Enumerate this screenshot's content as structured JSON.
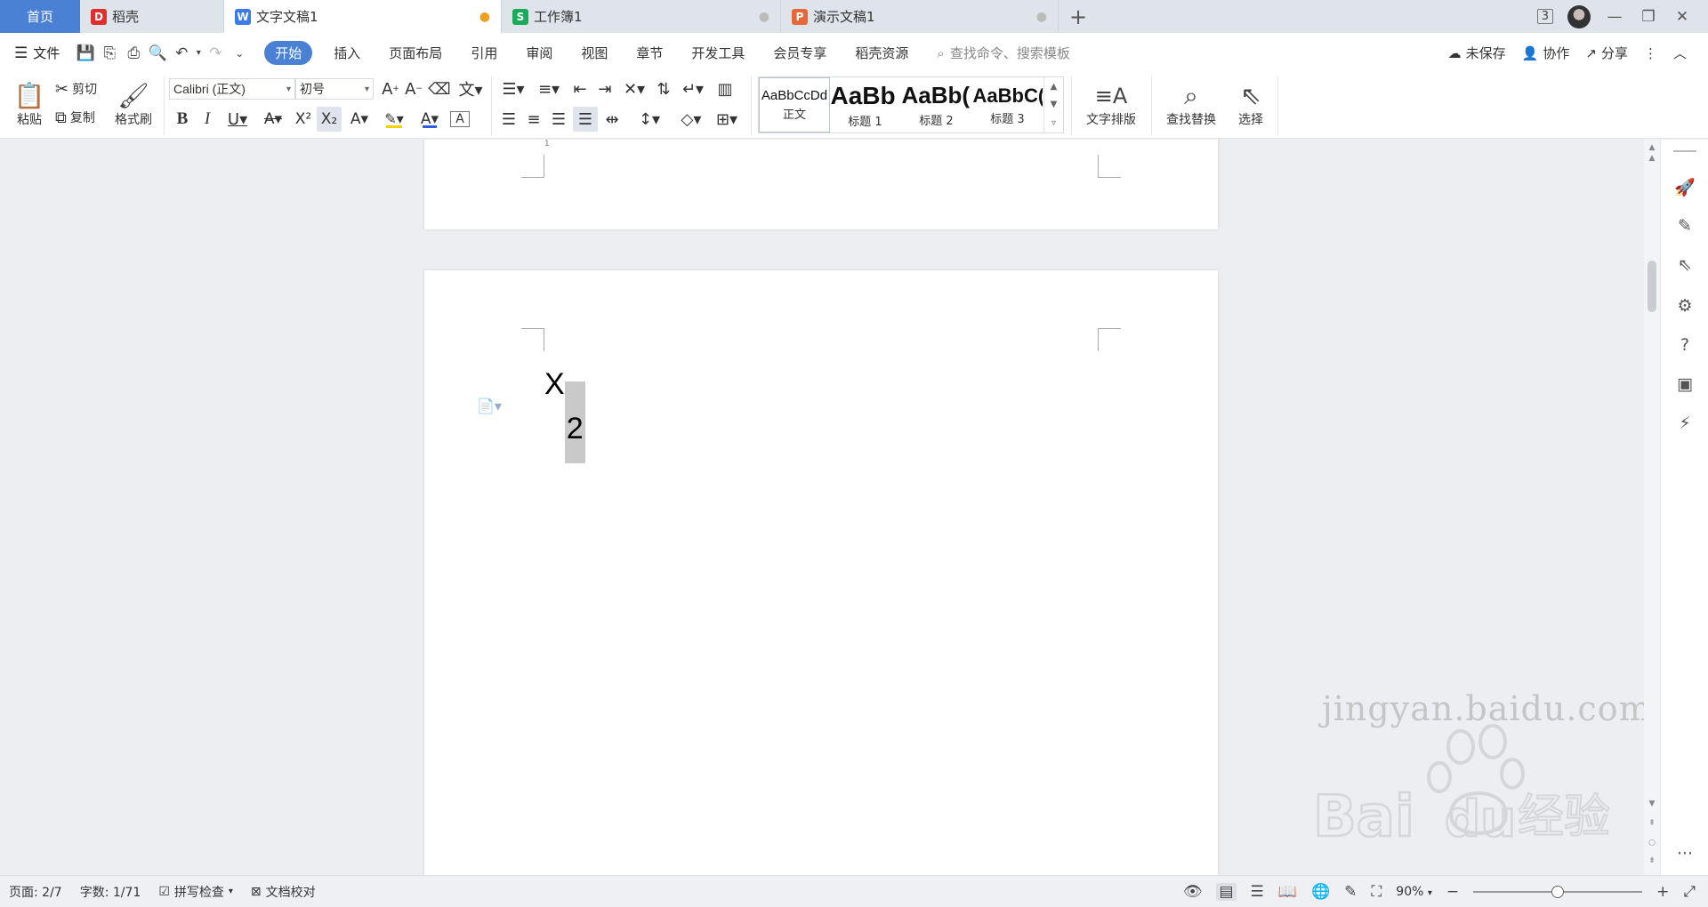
{
  "tabs": {
    "home": "首页",
    "items": [
      {
        "label": "稻壳",
        "icon": "daoke-icon",
        "color": "#e02d2d",
        "glyph": "D"
      },
      {
        "label": "文字文稿1",
        "icon": "writer-icon",
        "color": "#3b7bea",
        "glyph": "W",
        "active": true
      },
      {
        "label": "工作簿1",
        "icon": "spreadsheet-icon",
        "color": "#1aab5a",
        "glyph": "S"
      },
      {
        "label": "演示文稿1",
        "icon": "presentation-icon",
        "color": "#e4683a",
        "glyph": "P"
      }
    ],
    "window_count": "3"
  },
  "menu": {
    "file": "文件",
    "tabs": [
      "开始",
      "插入",
      "页面布局",
      "引用",
      "审阅",
      "视图",
      "章节",
      "开发工具",
      "会员专享",
      "稻壳资源"
    ],
    "active_tab": "开始",
    "search_placeholder": "查找命令、搜索模板",
    "unsaved": "未保存",
    "collab": "协作",
    "share": "分享"
  },
  "ribbon": {
    "paste": "粘贴",
    "cut": "剪切",
    "copy": "复制",
    "format_painter": "格式刷",
    "font_name": "Calibri (正文)",
    "font_size": "初号",
    "styles": [
      {
        "sample": "AaBbCcDd",
        "name": "正文"
      },
      {
        "sample": "AaBb",
        "name": "标题 1"
      },
      {
        "sample": "AaBb(",
        "name": "标题 2"
      },
      {
        "sample": "AaBbC(",
        "name": "标题 3"
      }
    ],
    "text_layout": "文字排版",
    "find_replace": "查找替换",
    "select": "选择"
  },
  "document": {
    "ruler_num": "1",
    "base_char": "X",
    "subscript_char": "2"
  },
  "watermark": {
    "brand": "Bai",
    "brand2": "du",
    "suffix": "经验",
    "url": "jingyan.baidu.com"
  },
  "status": {
    "page": "页面: 2/7",
    "words": "字数: 1/71",
    "spellcheck": "拼写检查",
    "doc_check": "文档校对",
    "zoom": "90%",
    "zoom_level": 0.5
  },
  "colors": {
    "accent": "#4b81d4",
    "highlight_bar": "#f3d200",
    "font_color_bar": "#2f5fe0"
  }
}
